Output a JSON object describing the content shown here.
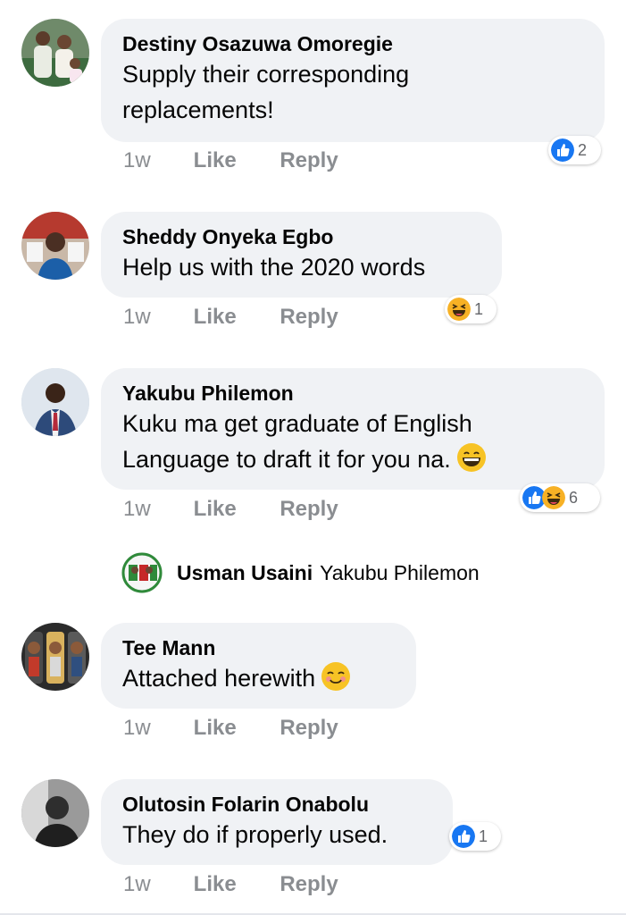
{
  "comments": [
    {
      "name": "Destiny Osazuwa Omoregie",
      "text_lines": [
        "Supply their corresponding",
        "replacements!"
      ],
      "time": "1w",
      "like": "Like",
      "reply": "Reply",
      "reaction_icons": [
        "like-icon"
      ],
      "reaction_count": "2"
    },
    {
      "name": "Sheddy Onyeka Egbo",
      "text_lines": [
        "Help us with the 2020 words"
      ],
      "time": "1w",
      "like": "Like",
      "reply": "Reply",
      "reaction_icons": [
        "haha-icon"
      ],
      "reaction_count": "1"
    },
    {
      "name": "Yakubu Philemon",
      "text_lines": [
        "Kuku ma get graduate of English",
        "Language to draft it for you na."
      ],
      "text_emoji": "grinning-face-icon",
      "time": "1w",
      "like": "Like",
      "reply": "Reply",
      "reaction_icons": [
        "like-icon",
        "haha-icon"
      ],
      "reaction_count": "6"
    },
    {
      "name": "Tee Mann",
      "text_lines": [
        "Attached herewith"
      ],
      "text_emoji": "smiling-face-icon",
      "time": "1w",
      "like": "Like",
      "reply": "Reply"
    },
    {
      "name": "Olutosin Folarin Onabolu",
      "text_lines": [
        "They do if properly used."
      ],
      "time": "1w",
      "like": "Like",
      "reply": "Reply",
      "reaction_icons": [
        "like-icon"
      ],
      "reaction_count": "1"
    }
  ],
  "reply_preview": {
    "name": "Usman Usaini",
    "text": "Yakubu Philemon"
  },
  "colors": {
    "bubble": "#f0f2f5",
    "meta_text": "#8a8d91",
    "like_blue": "#1877f2",
    "haha_yellow": "#f7b125"
  }
}
